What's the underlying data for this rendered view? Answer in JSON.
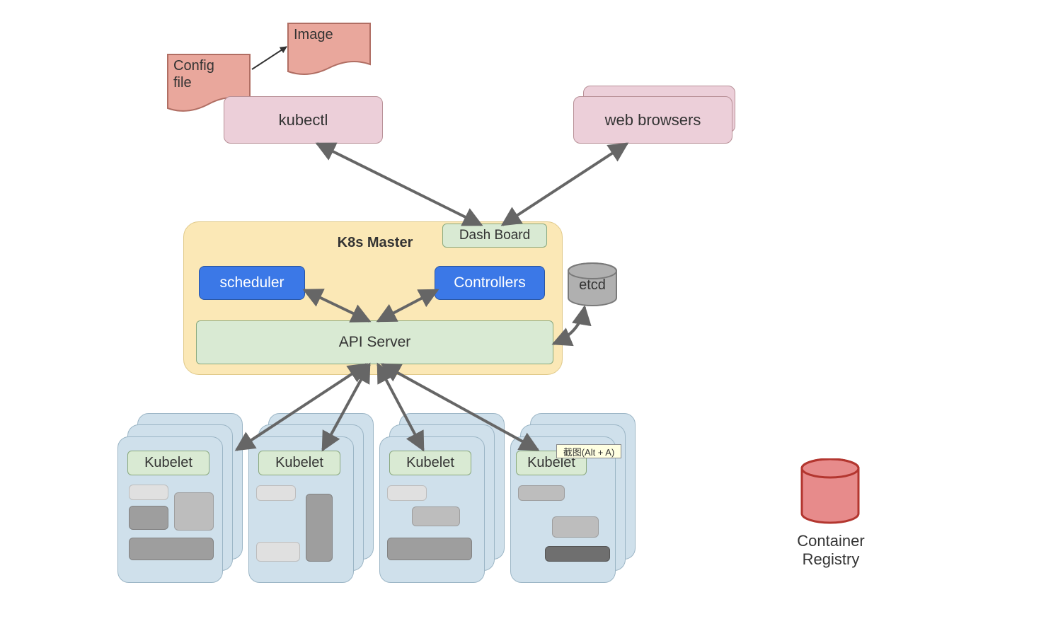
{
  "inputs": {
    "config_file": "Config\nfile",
    "image": "Image",
    "kubectl": "kubectl",
    "web_browsers": "web browsers"
  },
  "master": {
    "title": "K8s Master",
    "dashboard": "Dash Board",
    "scheduler": "scheduler",
    "controllers": "Controllers",
    "api_server": "API Server",
    "etcd": "etcd"
  },
  "nodes": {
    "kubelet": "Kubelet"
  },
  "registry": {
    "label": "Container\nRegistry"
  },
  "tooltip": "截图(Alt + A)",
  "colors": {
    "pink": "#eccfd9",
    "green": "#d9ead3",
    "blue": "#3b78e7",
    "yellow": "#fbe8b6",
    "node": "#cfe0eb",
    "etcd": "#b0b0b0",
    "registry": "#e78b8b",
    "arrow": "#666666"
  }
}
